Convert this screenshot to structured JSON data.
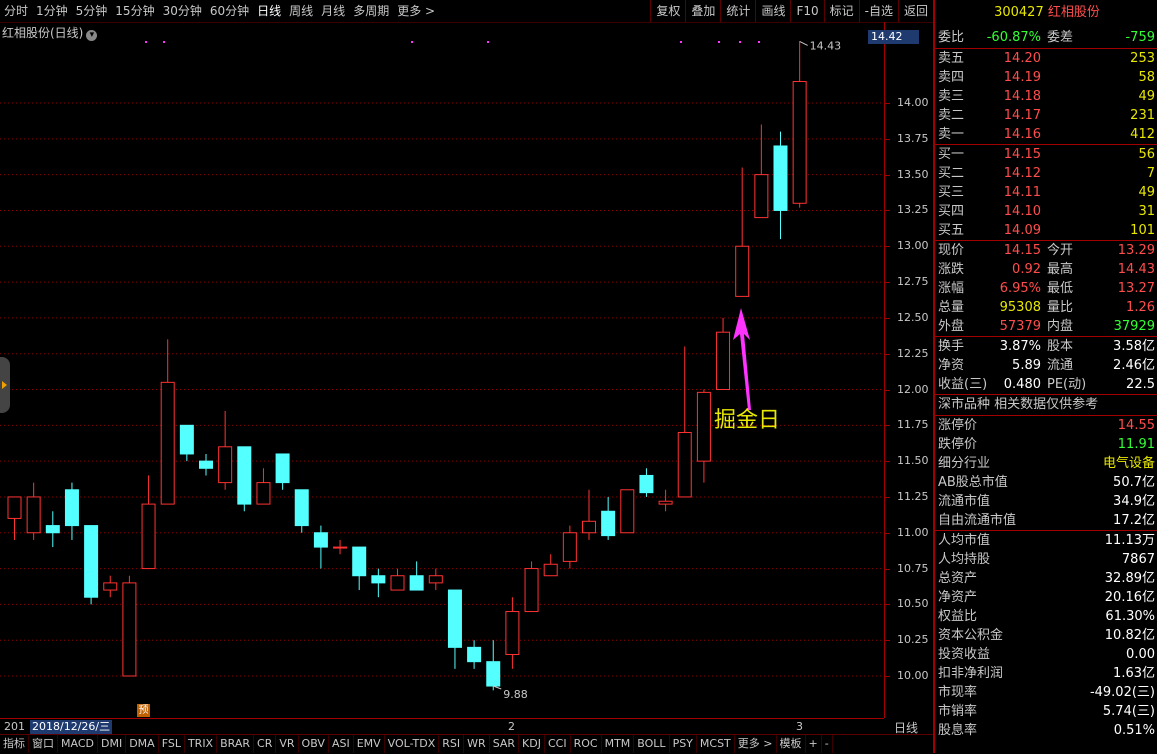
{
  "toolbar": {
    "periods": [
      "分时",
      "1分钟",
      "5分钟",
      "15分钟",
      "30分钟",
      "60分钟",
      "日线",
      "周线",
      "月线",
      "多周期",
      "更多 >"
    ],
    "active_period": "日线",
    "tools": [
      "复权",
      "叠加",
      "统计",
      "画线",
      "F10",
      "标记",
      "-自选",
      "返回"
    ]
  },
  "chart": {
    "title": "红相股份(日线)",
    "current_price_tag": "14.42",
    "high_label": "14.43",
    "low_label": "9.88",
    "annotation": "掘金日",
    "yu_badge": "预",
    "date_selected": "2018/12/26/三",
    "date_left": "201",
    "date_marks": [
      "2",
      "3"
    ],
    "period_label": "日线",
    "axis_ticks": [
      "14.00",
      "13.75",
      "13.50",
      "13.25",
      "13.00",
      "12.75",
      "12.50",
      "12.25",
      "12.00",
      "11.75",
      "11.50",
      "11.25",
      "11.00",
      "10.75",
      "10.50",
      "10.25",
      "10.00"
    ],
    "colors": {
      "up": "#ff3232",
      "down": "#54ffff",
      "ma": "#e8e800",
      "grid": "#8a0000",
      "arrow": "#ff33ff"
    }
  },
  "chart_data": {
    "type": "candlestick",
    "ylim": [
      9.75,
      14.5
    ],
    "candles": [
      {
        "o": 11.1,
        "h": 11.25,
        "l": 10.95,
        "c": 11.25
      },
      {
        "o": 11.0,
        "h": 11.35,
        "l": 10.95,
        "c": 11.25
      },
      {
        "o": 11.05,
        "h": 11.15,
        "l": 10.9,
        "c": 11.0
      },
      {
        "o": 11.3,
        "h": 11.35,
        "l": 10.95,
        "c": 11.05
      },
      {
        "o": 11.05,
        "h": 11.05,
        "l": 10.5,
        "c": 10.55
      },
      {
        "o": 10.6,
        "h": 10.7,
        "l": 10.55,
        "c": 10.65
      },
      {
        "o": 10.0,
        "h": 10.7,
        "l": 10.0,
        "c": 10.65
      },
      {
        "o": 10.75,
        "h": 11.4,
        "l": 10.75,
        "c": 11.2
      },
      {
        "o": 11.2,
        "h": 12.35,
        "l": 11.2,
        "c": 12.05
      },
      {
        "o": 11.75,
        "h": 11.75,
        "l": 11.5,
        "c": 11.55
      },
      {
        "o": 11.5,
        "h": 11.55,
        "l": 11.4,
        "c": 11.45
      },
      {
        "o": 11.35,
        "h": 11.85,
        "l": 11.3,
        "c": 11.6
      },
      {
        "o": 11.6,
        "h": 11.6,
        "l": 11.15,
        "c": 11.2
      },
      {
        "o": 11.2,
        "h": 11.45,
        "l": 11.2,
        "c": 11.35
      },
      {
        "o": 11.55,
        "h": 11.55,
        "l": 11.3,
        "c": 11.35
      },
      {
        "o": 11.3,
        "h": 11.3,
        "l": 11.0,
        "c": 11.05
      },
      {
        "o": 11.0,
        "h": 11.05,
        "l": 10.75,
        "c": 10.9
      },
      {
        "o": 10.9,
        "h": 10.95,
        "l": 10.85,
        "c": 10.9
      },
      {
        "o": 10.9,
        "h": 10.9,
        "l": 10.6,
        "c": 10.7
      },
      {
        "o": 10.7,
        "h": 10.75,
        "l": 10.55,
        "c": 10.65
      },
      {
        "o": 10.6,
        "h": 10.75,
        "l": 10.6,
        "c": 10.7
      },
      {
        "o": 10.7,
        "h": 10.8,
        "l": 10.6,
        "c": 10.6
      },
      {
        "o": 10.65,
        "h": 10.75,
        "l": 10.6,
        "c": 10.7
      },
      {
        "o": 10.6,
        "h": 10.55,
        "l": 10.05,
        "c": 10.2
      },
      {
        "o": 10.2,
        "h": 10.25,
        "l": 10.05,
        "c": 10.1
      },
      {
        "o": 10.1,
        "h": 10.25,
        "l": 9.9,
        "c": 9.93
      },
      {
        "o": 10.15,
        "h": 10.55,
        "l": 10.05,
        "c": 10.45
      },
      {
        "o": 10.45,
        "h": 10.8,
        "l": 10.45,
        "c": 10.75
      },
      {
        "o": 10.7,
        "h": 10.85,
        "l": 10.7,
        "c": 10.78
      },
      {
        "o": 10.8,
        "h": 11.05,
        "l": 10.75,
        "c": 11.0
      },
      {
        "o": 11.0,
        "h": 11.3,
        "l": 10.95,
        "c": 11.08
      },
      {
        "o": 11.15,
        "h": 11.25,
        "l": 10.95,
        "c": 10.98
      },
      {
        "o": 11.0,
        "h": 11.3,
        "l": 11.0,
        "c": 11.3
      },
      {
        "o": 11.4,
        "h": 11.45,
        "l": 11.25,
        "c": 11.28
      },
      {
        "o": 11.2,
        "h": 11.3,
        "l": 11.15,
        "c": 11.22
      },
      {
        "o": 11.25,
        "h": 12.3,
        "l": 11.25,
        "c": 11.7
      },
      {
        "o": 11.5,
        "h": 12.0,
        "l": 11.35,
        "c": 11.98
      },
      {
        "o": 12.0,
        "h": 12.5,
        "l": 12.0,
        "c": 12.4
      },
      {
        "o": 12.65,
        "h": 13.55,
        "l": 12.65,
        "c": 13.0
      },
      {
        "o": 13.2,
        "h": 13.85,
        "l": 13.2,
        "c": 13.5
      },
      {
        "o": 13.7,
        "h": 13.8,
        "l": 13.05,
        "c": 13.25
      },
      {
        "o": 13.3,
        "h": 14.43,
        "l": 13.27,
        "c": 14.15
      }
    ]
  },
  "panel": {
    "code": "300427",
    "name": "红相股份",
    "wb": {
      "label1": "委比",
      "value1": "-60.87%",
      "label2": "委差",
      "value2": "-759"
    },
    "asks": [
      {
        "k": "卖五",
        "p": "14.20",
        "v": "253"
      },
      {
        "k": "卖四",
        "p": "14.19",
        "v": "58"
      },
      {
        "k": "卖三",
        "p": "14.18",
        "v": "49"
      },
      {
        "k": "卖二",
        "p": "14.17",
        "v": "231"
      },
      {
        "k": "卖一",
        "p": "14.16",
        "v": "412"
      }
    ],
    "bids": [
      {
        "k": "买一",
        "p": "14.15",
        "v": "56"
      },
      {
        "k": "买二",
        "p": "14.12",
        "v": "7"
      },
      {
        "k": "买三",
        "p": "14.11",
        "v": "49"
      },
      {
        "k": "买四",
        "p": "14.10",
        "v": "31"
      },
      {
        "k": "买五",
        "p": "14.09",
        "v": "101"
      }
    ],
    "quote": [
      {
        "k1": "现价",
        "v1": "14.15",
        "c1": "red",
        "k2": "今开",
        "v2": "13.29",
        "c2": "red"
      },
      {
        "k1": "涨跌",
        "v1": "0.92",
        "c1": "red",
        "k2": "最高",
        "v2": "14.43",
        "c2": "red"
      },
      {
        "k1": "涨幅",
        "v1": "6.95%",
        "c1": "red",
        "k2": "最低",
        "v2": "13.27",
        "c2": "red"
      },
      {
        "k1": "总量",
        "v1": "95308",
        "c1": "yellow",
        "k2": "量比",
        "v2": "1.26",
        "c2": "red"
      },
      {
        "k1": "外盘",
        "v1": "57379",
        "c1": "red",
        "k2": "内盘",
        "v2": "37929",
        "c2": "green"
      }
    ],
    "fund": [
      {
        "k1": "换手",
        "v1": "3.87%",
        "k2": "股本",
        "v2": "3.58亿"
      },
      {
        "k1": "净资",
        "v1": "5.89",
        "k2": "流通",
        "v2": "2.46亿"
      },
      {
        "k1": "收益(三)",
        "v1": "0.480",
        "k2": "PE(动)",
        "v2": "22.5"
      }
    ],
    "section_title": "深市品种  相关数据仅供参考",
    "limits": [
      {
        "k": "涨停价",
        "v": "14.55",
        "c": "red"
      },
      {
        "k": "跌停价",
        "v": "11.91",
        "c": "green"
      },
      {
        "k": "细分行业",
        "v": "电气设备",
        "c": "yellow"
      }
    ],
    "stats": [
      {
        "k": "AB股总市值",
        "v": "50.7亿"
      },
      {
        "k": "流通市值",
        "v": "34.9亿"
      },
      {
        "k": "自由流通市值",
        "v": "17.2亿"
      },
      {
        "k": "人均市值",
        "v": "11.13万"
      },
      {
        "k": "人均持股",
        "v": "7867"
      },
      {
        "k": "总资产",
        "v": "32.89亿"
      },
      {
        "k": "净资产",
        "v": "20.16亿"
      },
      {
        "k": "权益比",
        "v": "61.30%"
      },
      {
        "k": "资本公积金",
        "v": "10.82亿"
      },
      {
        "k": "投资收益",
        "v": "0.00"
      },
      {
        "k": "扣非净利润",
        "v": "1.63亿"
      },
      {
        "k": "市现率",
        "v": "-49.02(三)"
      },
      {
        "k": "市销率",
        "v": "5.74(三)"
      },
      {
        "k": "股息率",
        "v": "0.51%"
      }
    ]
  },
  "indicators": [
    "指标",
    "窗口",
    "MACD",
    "DMI",
    "DMA",
    "FSL",
    "TRIX",
    "BRAR",
    "CR",
    "VR",
    "OBV",
    "ASI",
    "EMV",
    "VOL-TDX",
    "RSI",
    "WR",
    "SAR",
    "KDJ",
    "CCI",
    "ROC",
    "MTM",
    "BOLL",
    "PSY",
    "MCST",
    "更多 >",
    "模板",
    "+",
    "-"
  ]
}
